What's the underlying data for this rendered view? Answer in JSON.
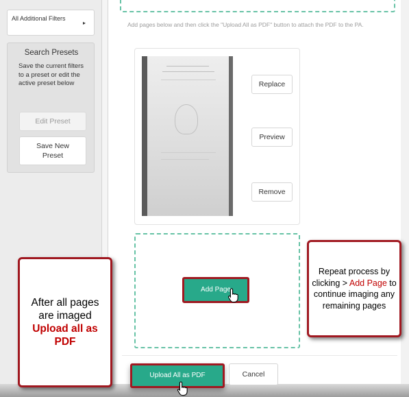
{
  "sidebar": {
    "filters_button": {
      "label": "All Additional Filters",
      "caret": "▸"
    },
    "presets": {
      "title": "Search Presets",
      "description": "Save the current filters to a preset or edit the active preset below",
      "edit_label": "Edit Preset",
      "save_label": "Save New Preset"
    }
  },
  "main": {
    "instruction": "Add pages below and then click the \"Upload All as PDF\" button to attach the PDF to the PA.",
    "page_card": {
      "replace_label": "Replace",
      "preview_label": "Preview",
      "remove_label": "Remove"
    },
    "add_page_label": "Add Page",
    "upload_label": "Upload All as PDF",
    "cancel_label": "Cancel"
  },
  "callouts": {
    "left": {
      "line1": "After all pages are imaged",
      "highlight": "Upload all as PDF"
    },
    "right": {
      "before": "Repeat process by clicking > ",
      "highlight": "Add Page",
      "after": " to continue imaging any remaining pages"
    }
  },
  "colors": {
    "accent_green": "#28a98a",
    "dashed_green": "#66c2a5",
    "callout_red": "#a01820",
    "highlight_red": "#c00000"
  },
  "icons": {
    "caret": "caret-right-icon",
    "cursor": "hand-pointer-icon"
  }
}
